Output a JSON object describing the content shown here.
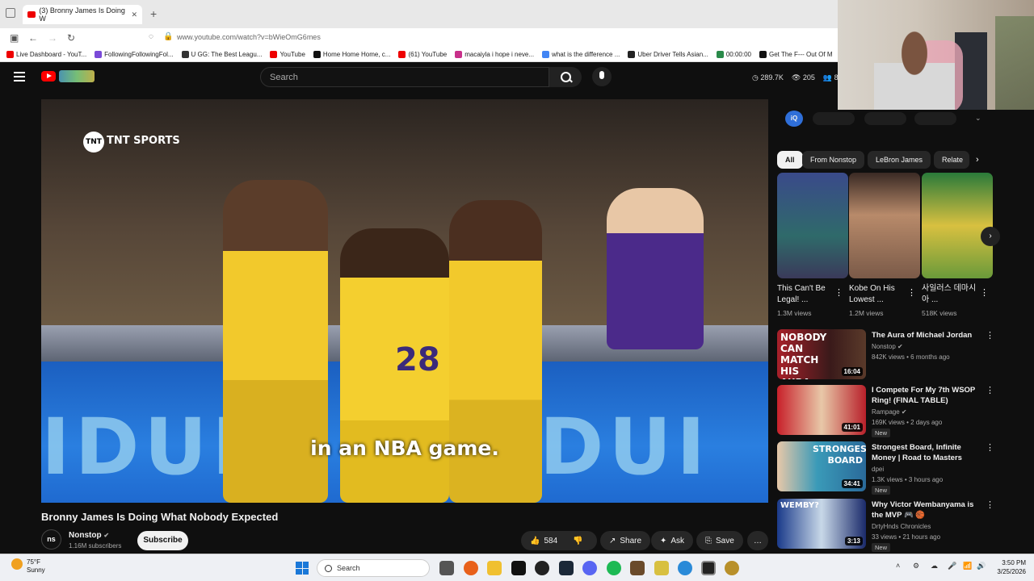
{
  "browser": {
    "tab_title": "(3) Bronny James Is Doing W",
    "url": "www.youtube.com/watch?v=bWieOmG6mes",
    "bookmarks": [
      "Live Dashboard - YouT...",
      "FollowingFollowingFol...",
      "U GG: The Best Leagu...",
      "YouTube",
      "Home Home Home, c...",
      "(61) YouTube",
      "macaiyla i hope i neve...",
      "what is the difference ...",
      "Uber Driver Tells Asian...",
      "00:00:00",
      "Get The F--- Out Of M"
    ]
  },
  "header": {
    "search_placeholder": "Search",
    "stat_views": "289.7K",
    "stat_count": "205",
    "stat_other": "8,60"
  },
  "video": {
    "overlay_logo": "TNT SPORTS",
    "caption": "in an NBA game.",
    "board_text": "IDUEL  FANDUI",
    "jersey_number": "28",
    "title": "Bronny James Is Doing What Nobody Expected",
    "channel": "Nonstop",
    "channel_logo": "ns",
    "subscribers": "1.16M subscribers",
    "subscribe_label": "Subscribe",
    "likes": "584",
    "share_label": "Share",
    "ask_label": "Ask",
    "save_label": "Save"
  },
  "sidebar": {
    "iq_badge": "iQ",
    "chips": [
      "All",
      "From Nonstop",
      "LeBron James",
      "Relate"
    ],
    "shorts": [
      {
        "title": "This Can't Be Legal! ...",
        "views": "1.3M views"
      },
      {
        "title": "Kobe On His Lowest ...",
        "views": "1.2M views"
      },
      {
        "title": "사일러스 데마시아 ...",
        "views": "518K views"
      }
    ],
    "videos": [
      {
        "title": "The Aura of Michael Jordan",
        "channel": "Nonstop",
        "meta": "842K views • 6 months ago",
        "duration": "16:04",
        "thumb_text": "NOBODY CAN MATCH HIS AURA",
        "badge": ""
      },
      {
        "title": "I Compete For My 7th WSOP Ring! (FINAL TABLE)",
        "channel": "Rampage",
        "meta": "169K views • 2 days ago",
        "duration": "41:01",
        "thumb_text": "",
        "badge": "New"
      },
      {
        "title": "Strongest Board, Infinite Money | Road to Masters",
        "channel": "dpei",
        "meta": "1.3K views • 3 hours ago",
        "duration": "34:41",
        "thumb_text": "STRONGEST BOARD",
        "badge": "New"
      },
      {
        "title": "Why Victor Wembanyama is the MVP 🎮 🏀",
        "channel": "DrtyHnds Chronicles",
        "meta": "33 views • 21 hours ago",
        "duration": "3:13",
        "thumb_text": "WEMBY?",
        "badge": "New"
      }
    ]
  },
  "taskbar": {
    "temp": "75°F",
    "condition": "Sunny",
    "search_placeholder": "Search",
    "time": "3:50 PM",
    "date": "3/25/2026"
  }
}
